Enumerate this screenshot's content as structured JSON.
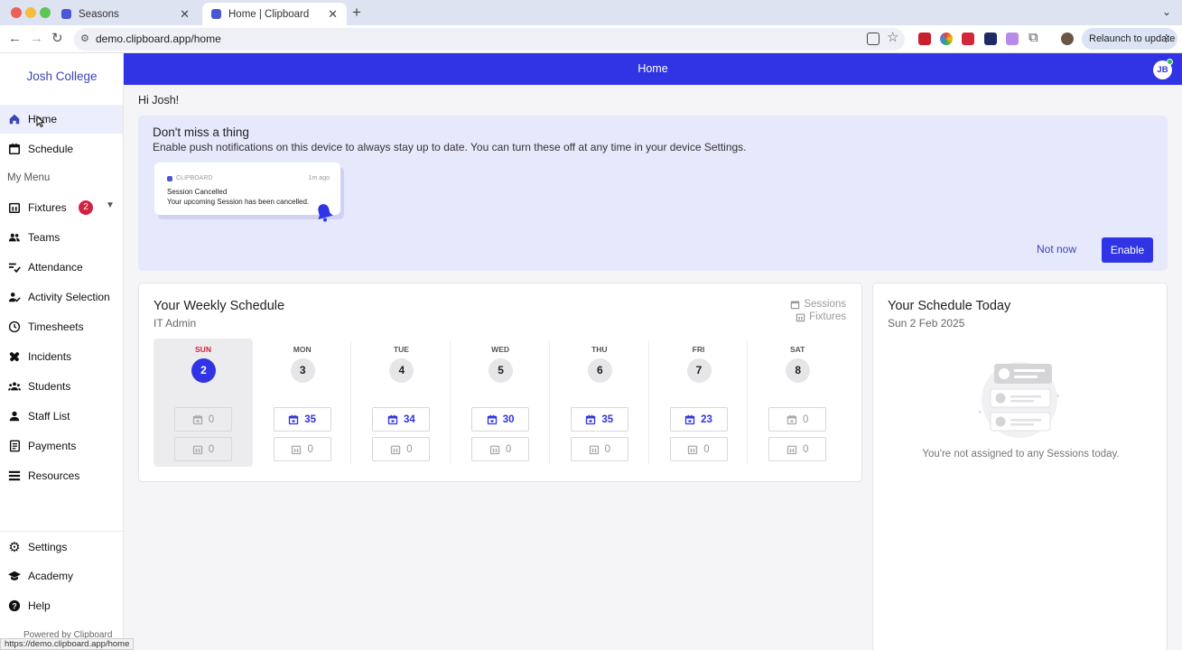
{
  "browser": {
    "tabs": [
      {
        "title": "Seasons",
        "active": false
      },
      {
        "title": "Home | Clipboard",
        "active": true
      }
    ],
    "url": "demo.clipboard.app/home",
    "relaunch_label": "Relaunch to update",
    "status_url": "https://demo.clipboard.app/home"
  },
  "sidebar": {
    "org_name": "Josh College",
    "top_items": [
      {
        "label": "Home",
        "icon": "home-icon"
      },
      {
        "label": "Schedule",
        "icon": "calendar-icon"
      }
    ],
    "menu_label": "My Menu",
    "menu_items": [
      {
        "label": "Fixtures",
        "icon": "fixtures-icon",
        "badge": "2"
      },
      {
        "label": "Teams",
        "icon": "teams-icon"
      },
      {
        "label": "Attendance",
        "icon": "attendance-icon"
      },
      {
        "label": "Activity Selection",
        "icon": "activity-selection-icon"
      },
      {
        "label": "Timesheets",
        "icon": "clock-icon"
      },
      {
        "label": "Incidents",
        "icon": "incidents-icon"
      },
      {
        "label": "Students",
        "icon": "students-icon"
      },
      {
        "label": "Staff List",
        "icon": "staff-icon"
      },
      {
        "label": "Payments",
        "icon": "payments-icon"
      },
      {
        "label": "Resources",
        "icon": "resources-icon"
      }
    ],
    "bottom_items": [
      {
        "label": "Settings",
        "icon": "gear-icon"
      },
      {
        "label": "Academy",
        "icon": "academy-icon"
      },
      {
        "label": "Help",
        "icon": "help-icon"
      }
    ],
    "powered_by": "Powered by Clipboard"
  },
  "header": {
    "title": "Home",
    "avatar_initials": "JB"
  },
  "greeting": "Hi Josh!",
  "banner": {
    "title": "Don't miss a thing",
    "text": "Enable push notifications on this device to always stay up to date. You can turn these off at any time in your device Settings.",
    "preview": {
      "app": "CLIPBOARD",
      "time": "1m ago",
      "title": "Session Cancelled",
      "body": "Your upcoming Session has been cancelled."
    },
    "not_now_label": "Not now",
    "enable_label": "Enable"
  },
  "weekly": {
    "title": "Your Weekly Schedule",
    "subtitle": "IT Admin",
    "legend_sessions": "Sessions",
    "legend_fixtures": "Fixtures",
    "days": [
      {
        "name": "SUN",
        "date": "2",
        "sessions": "0",
        "fixtures": "0",
        "today": true
      },
      {
        "name": "MON",
        "date": "3",
        "sessions": "35",
        "fixtures": "0"
      },
      {
        "name": "TUE",
        "date": "4",
        "sessions": "34",
        "fixtures": "0"
      },
      {
        "name": "WED",
        "date": "5",
        "sessions": "30",
        "fixtures": "0"
      },
      {
        "name": "THU",
        "date": "6",
        "sessions": "35",
        "fixtures": "0"
      },
      {
        "name": "FRI",
        "date": "7",
        "sessions": "23",
        "fixtures": "0"
      },
      {
        "name": "SAT",
        "date": "8",
        "sessions": "0",
        "fixtures": "0"
      }
    ]
  },
  "today": {
    "title": "Your Schedule Today",
    "date": "Sun 2 Feb 2025",
    "empty_text": "You're not assigned to any Sessions today."
  },
  "colors": {
    "brand": "#3034e4",
    "badge": "#d42242",
    "banner_bg": "#e6e8fb"
  }
}
